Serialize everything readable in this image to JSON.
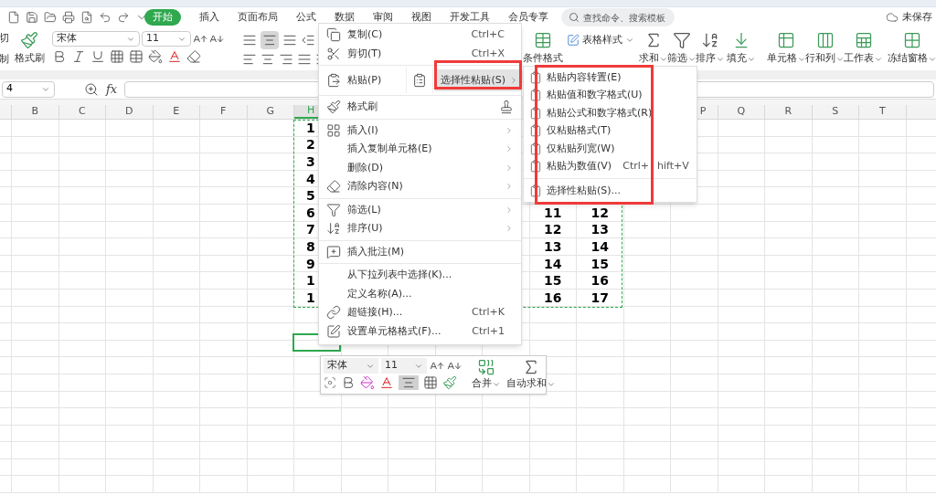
{
  "menu_bar": {
    "tabs": [
      {
        "label": "开始",
        "selected": true
      },
      {
        "label": "插入",
        "selected": false
      },
      {
        "label": "页面布局",
        "selected": false
      },
      {
        "label": "公式",
        "selected": false
      },
      {
        "label": "数据",
        "selected": false
      },
      {
        "label": "审阅",
        "selected": false
      },
      {
        "label": "视图",
        "selected": false
      },
      {
        "label": "开发工具",
        "selected": false
      },
      {
        "label": "会员专享",
        "selected": false
      }
    ],
    "search": {
      "placeholder": "查找命令、搜索模板"
    },
    "save_status": "未保存"
  },
  "ribbon": {
    "clipped": [
      "切",
      "制"
    ],
    "format_painter": "格式刷",
    "font": {
      "name": "宋体",
      "size": "11"
    },
    "align_center_selected": true,
    "conditional_format": "条件格式",
    "table_style": "表格样式",
    "large_buttons": [
      {
        "label": "求和"
      },
      {
        "label": "筛选"
      },
      {
        "label": "排序"
      },
      {
        "label": "填充"
      },
      {
        "label": "单元格"
      },
      {
        "label": "行和列"
      },
      {
        "label": "工作表"
      },
      {
        "label": "冻结窗格"
      }
    ]
  },
  "formula_bar": {
    "cell_ref": "4",
    "fx": "fx"
  },
  "sheet": {
    "headers_left": [
      "B",
      "C",
      "D",
      "E",
      "F",
      "G",
      "H"
    ],
    "headers_right": [
      "P",
      "Q",
      "R",
      "S",
      "T"
    ],
    "rows": [
      {
        "H": "1"
      },
      {
        "H": "2"
      },
      {
        "H": "3"
      },
      {
        "H": "4"
      },
      {
        "H": "5"
      },
      {
        "H": "6",
        "M": "11",
        "N": "12"
      },
      {
        "H": "7",
        "M": "12",
        "N": "13"
      },
      {
        "H": "8",
        "M": "13",
        "N": "14"
      },
      {
        "H": "9",
        "M": "14",
        "N": "15"
      },
      {
        "H": "1",
        "M": "15",
        "N": "16"
      },
      {
        "H": "1",
        "M": "16",
        "N": "17"
      }
    ]
  },
  "context_menu": {
    "groups": [
      [
        {
          "kind": "item",
          "label": "复制(C)",
          "shortcut": "Ctrl+C",
          "has_submenu": false
        },
        {
          "kind": "item",
          "label": "剪切(T)",
          "shortcut": "Ctrl+X",
          "has_submenu": false
        }
      ],
      [
        {
          "kind": "split",
          "label": "粘贴(P)",
          "sub_label": "选择性粘贴(S)",
          "sub_selected": true
        }
      ],
      [
        {
          "kind": "item",
          "label": "格式刷",
          "has_submenu": false
        }
      ],
      [
        {
          "kind": "item",
          "label": "插入(I)",
          "has_submenu": true
        },
        {
          "kind": "item",
          "label": "插入复制单元格(E)",
          "has_submenu": true
        },
        {
          "kind": "item",
          "label": "删除(D)",
          "has_submenu": true
        },
        {
          "kind": "item",
          "label": "清除内容(N)",
          "has_submenu": true
        }
      ],
      [
        {
          "kind": "item",
          "label": "筛选(L)",
          "has_submenu": true
        },
        {
          "kind": "item",
          "label": "排序(U)",
          "has_submenu": true
        }
      ],
      [
        {
          "kind": "item",
          "label": "插入批注(M)",
          "has_submenu": false
        }
      ],
      [
        {
          "kind": "item",
          "label": "从下拉列表中选择(K)...",
          "has_submenu": false
        },
        {
          "kind": "item",
          "label": "定义名称(A)...",
          "has_submenu": false
        },
        {
          "kind": "item",
          "label": "超链接(H)...",
          "shortcut": "Ctrl+K",
          "has_submenu": false
        },
        {
          "kind": "item",
          "label": "设置单元格格式(F)...",
          "shortcut": "Ctrl+1",
          "has_submenu": false
        }
      ]
    ]
  },
  "submenu": {
    "groups": [
      [
        {
          "label": "粘贴内容转置(E)"
        },
        {
          "label": "粘贴值和数字格式(U)"
        },
        {
          "label": "粘贴公式和数字格式(R)"
        },
        {
          "label": "仅粘贴格式(T)"
        },
        {
          "label": "仅粘贴列宽(W)"
        },
        {
          "label": "粘贴为数值(V)",
          "shortcut_parts": [
            "Ctrl+",
            "hift+V"
          ]
        }
      ],
      [
        {
          "label": "选择性粘贴(S)..."
        }
      ]
    ]
  },
  "mini_toolbar": {
    "font": "宋体",
    "size": "11",
    "align_selected": true,
    "buttons": [
      {
        "label": "合并"
      },
      {
        "label": "自动求和"
      }
    ]
  }
}
